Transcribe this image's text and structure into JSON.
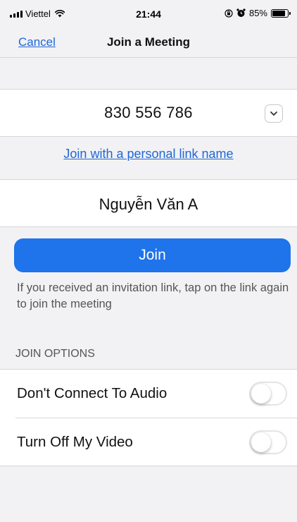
{
  "status_bar": {
    "carrier": "Viettel",
    "time": "21:44",
    "battery_percent": "85%",
    "battery_level": 0.85
  },
  "nav": {
    "cancel_label": "Cancel",
    "title": "Join a Meeting"
  },
  "meeting": {
    "id_value": "830 556 786",
    "dropdown_icon": "chevron-down-icon"
  },
  "personal_link_label": "Join with a personal link name",
  "name": {
    "value": "Nguyễn Văn A"
  },
  "join_button_label": "Join",
  "hint_text": "If you received an invitation link, tap on the link again to join the meeting",
  "join_options": {
    "header": "JOIN OPTIONS",
    "items": [
      {
        "label": "Don't Connect To Audio",
        "enabled": false
      },
      {
        "label": "Turn Off My Video",
        "enabled": false
      }
    ]
  },
  "colors": {
    "accent": "#1f73eb",
    "link": "#1f66d8",
    "background": "#f2f2f4"
  }
}
